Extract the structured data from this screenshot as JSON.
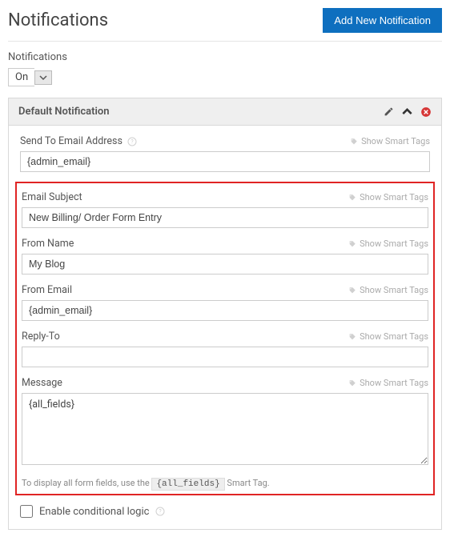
{
  "header": {
    "title": "Notifications",
    "add_button": "Add New Notification"
  },
  "toggle": {
    "label": "Notifications",
    "value": "On"
  },
  "panel": {
    "title": "Default Notification"
  },
  "smart_tags_label": "Show Smart Tags",
  "fields": {
    "send_to": {
      "label": "Send To Email Address",
      "value": "{admin_email}"
    },
    "subject": {
      "label": "Email Subject",
      "value": "New Billing/ Order Form Entry"
    },
    "from_name": {
      "label": "From Name",
      "value": "My Blog"
    },
    "from_email": {
      "label": "From Email",
      "value": "{admin_email}"
    },
    "reply_to": {
      "label": "Reply-To",
      "value": ""
    },
    "message": {
      "label": "Message",
      "value": "{all_fields}"
    }
  },
  "hint": {
    "prefix": "To display all form fields, use the ",
    "code": "{all_fields}",
    "suffix": " Smart Tag."
  },
  "conditional": {
    "label": "Enable conditional logic"
  }
}
